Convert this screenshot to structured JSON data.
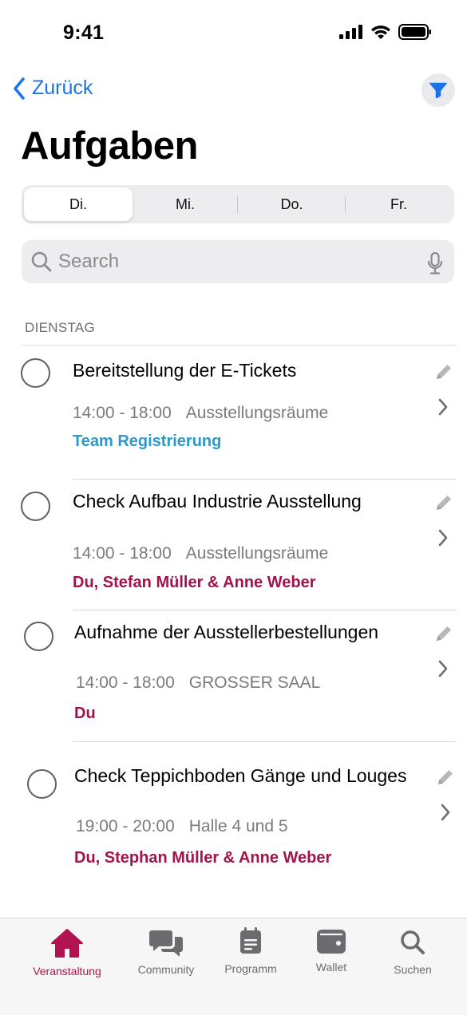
{
  "status_bar": {
    "time": "9:41"
  },
  "nav": {
    "back_label": "Zurück"
  },
  "title": "Aufgaben",
  "segments": [
    {
      "label": "Di.",
      "active": true
    },
    {
      "label": "Mi.",
      "active": false
    },
    {
      "label": "Do.",
      "active": false
    },
    {
      "label": "Fr.",
      "active": false
    }
  ],
  "search": {
    "placeholder": "Search"
  },
  "section": {
    "header": "DIENSTAG"
  },
  "tasks": [
    {
      "title": "Bereitstellung der E-Tickets",
      "time": "14:00 - 18:00",
      "location": "Ausstellungsräume",
      "assignee": "Team Registrierung",
      "assignee_color": "#2a9ac8"
    },
    {
      "title": "Check Aufbau Industrie Ausstellung",
      "time": "14:00 - 18:00",
      "location": "Ausstellungsräume",
      "assignee": "Du, Stefan Müller & Anne Weber",
      "assignee_color": "#a3124b"
    },
    {
      "title": "Aufnahme der Ausstellerbestellungen",
      "time": "14:00 - 18:00",
      "location": "GROSSER SAAL",
      "assignee": "Du",
      "assignee_color": "#a3124b"
    },
    {
      "title": "Check Teppichboden Gänge und Louges",
      "time": "19:00 - 20:00",
      "location": "Halle 4 und 5",
      "assignee": "Du, Stephan Müller & Anne Weber",
      "assignee_color": "#a3124b"
    }
  ],
  "tabbar": {
    "active_color": "#b0134f",
    "inactive_color": "#6b6b70",
    "items": [
      {
        "label": "Veranstaltung",
        "icon": "home-icon",
        "active": true
      },
      {
        "label": "Community",
        "icon": "chat-bubbles-icon",
        "active": false
      },
      {
        "label": "Programm",
        "icon": "calendar-icon",
        "active": false
      },
      {
        "label": "Wallet",
        "icon": "wallet-icon",
        "active": false
      },
      {
        "label": "Suchen",
        "icon": "search-icon",
        "active": false
      }
    ]
  },
  "colors": {
    "accent_blue": "#1a73e8"
  }
}
